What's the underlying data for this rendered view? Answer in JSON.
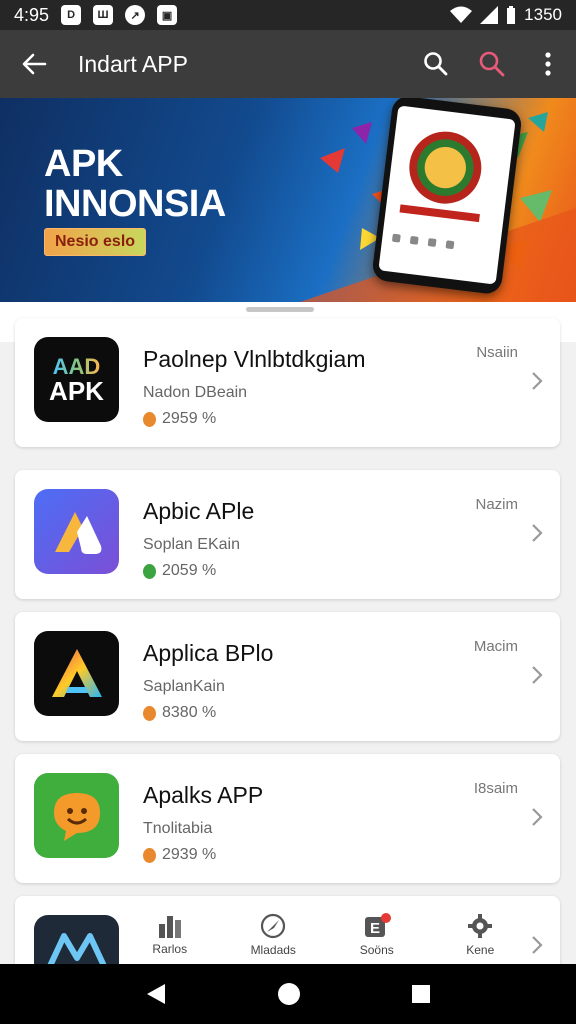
{
  "status_bar": {
    "time": "4:95",
    "battery_text": "1350",
    "icons": [
      "notification-icon",
      "gallery-icon",
      "compass-icon",
      "bag-icon"
    ]
  },
  "app_bar": {
    "title": "Indart APP",
    "back_icon": "back-arrow-icon",
    "actions": [
      "search-icon",
      "search-icon",
      "more-vert-icon"
    ],
    "accent_color": "#e85a7a"
  },
  "banner": {
    "title_line1": "APK",
    "title_line2": "INNONSIA",
    "badge": "Nesio eslo"
  },
  "apps": [
    {
      "name": "Paolnep Vlnlbtdkgiam",
      "developer": "Nadon DBeain",
      "stat": "2959 %",
      "size": "Nsaiin",
      "icon_text_1": "AAD",
      "icon_text_2": "APK",
      "dot_color": "#e8892e"
    },
    {
      "name": "Apbic APle",
      "developer": "Soplan EKain",
      "stat": "2059 %",
      "size": "Nazim",
      "dot_color": "#3ba33f"
    },
    {
      "name": "Applica BPlo",
      "developer": "SaplanKain",
      "stat": "8380 %",
      "size": "Macim",
      "dot_color": "#e8892e"
    },
    {
      "name": "Apalks APP",
      "developer": "Tnolitabia",
      "stat": "2939 %",
      "size": "I8saim",
      "dot_color": "#e8892e"
    }
  ],
  "bottom_nav": [
    {
      "label": "Rarlos",
      "icon": "chart-icon"
    },
    {
      "label": "Mladads",
      "icon": "compass-icon"
    },
    {
      "label": "Soöns",
      "icon": "notification-badge-icon"
    },
    {
      "label": "Kene",
      "icon": "gear-icon"
    }
  ]
}
